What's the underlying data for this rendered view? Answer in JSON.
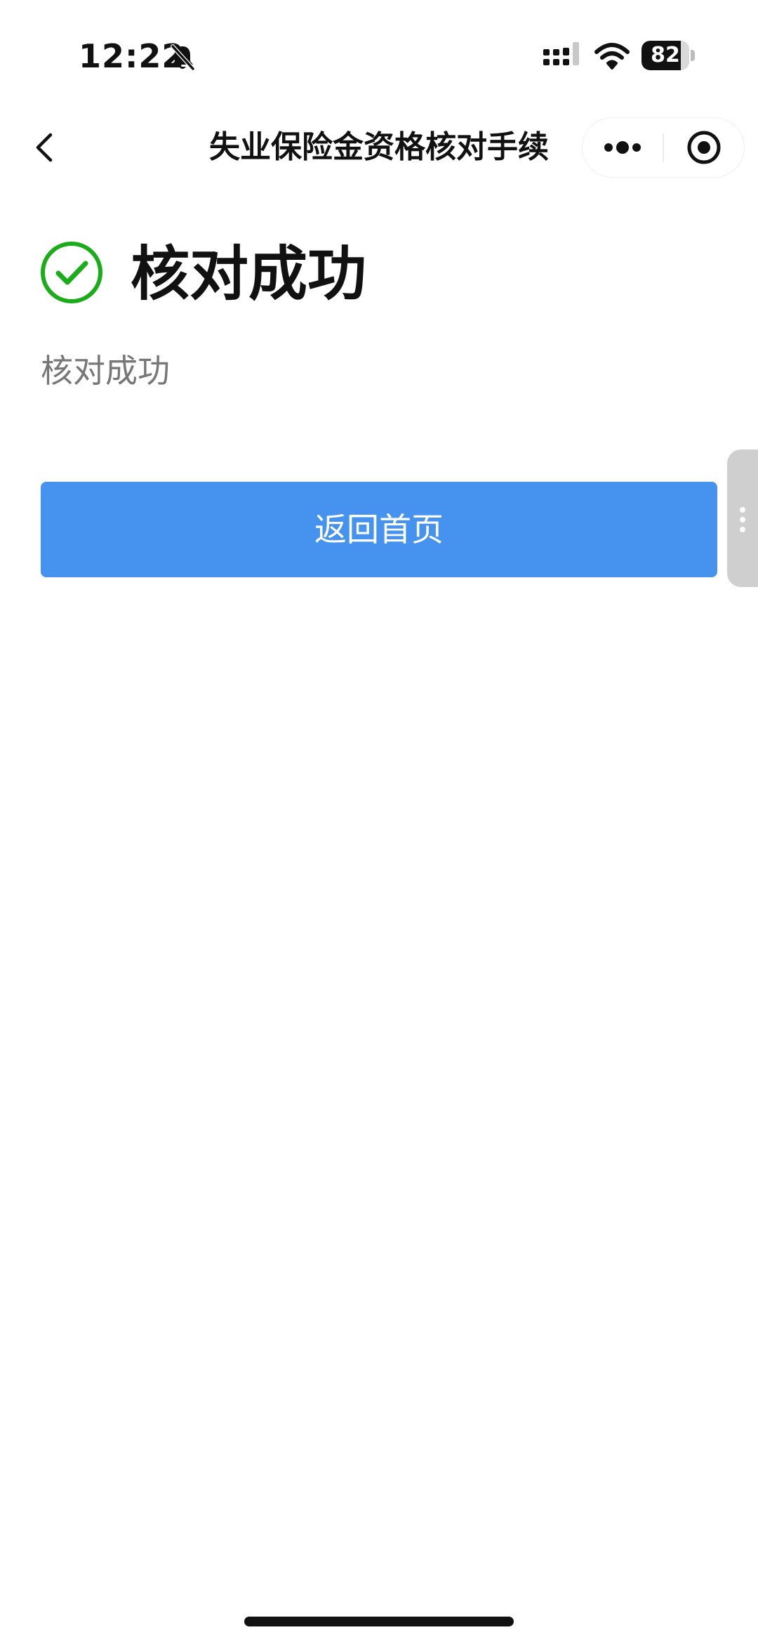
{
  "status_bar": {
    "time": "12:22",
    "battery_level": 82,
    "battery_label": "82",
    "silent_mode": true,
    "icons": [
      "bell-muted-icon",
      "signal-icon",
      "wifi-icon",
      "battery-icon"
    ]
  },
  "nav_bar": {
    "title": "失业保险金资格核对手续",
    "back_icon": "chevron-left-icon",
    "more_icon": "more-dots-icon",
    "close_icon": "target-close-icon"
  },
  "result": {
    "icon": "check-circle-icon",
    "icon_color": "#1aad19",
    "title": "核对成功",
    "message": "核对成功"
  },
  "actions": {
    "home_button_label": "返回首页",
    "home_button_color": "#4593ee"
  }
}
